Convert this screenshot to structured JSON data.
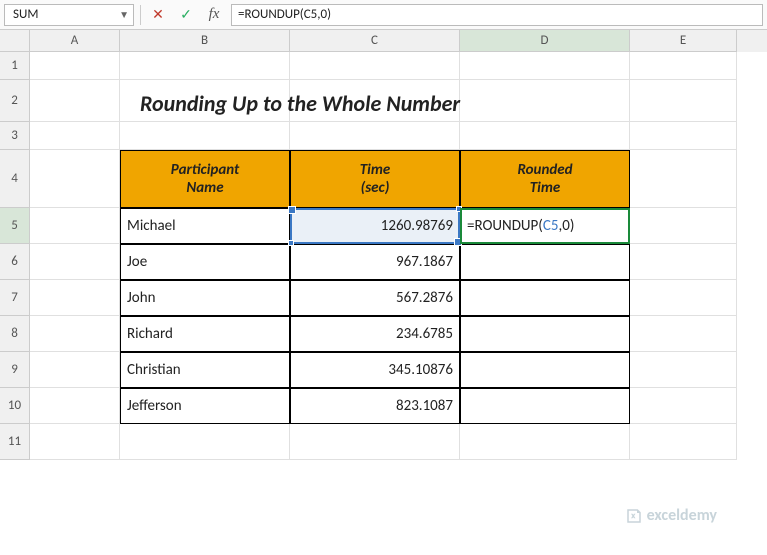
{
  "nameBox": "SUM",
  "formulaBar": "=ROUNDUP(C5,0)",
  "title": "Rounding Up to the Whole Number",
  "columns": [
    "A",
    "B",
    "C",
    "D",
    "E"
  ],
  "colWidths": {
    "A": 90,
    "B": 170,
    "C": 170,
    "D": 170,
    "E": 107
  },
  "headers": {
    "B": "Participant\nName",
    "C": "Time\n(sec)",
    "D": "Rounded\nTime"
  },
  "rows": [
    {
      "name": "Michael",
      "time": "1260.98769"
    },
    {
      "name": "Joe",
      "time": "967.1867"
    },
    {
      "name": "John",
      "time": "567.2876"
    },
    {
      "name": "Richard",
      "time": "234.6785"
    },
    {
      "name": "Christian",
      "time": "345.10876"
    },
    {
      "name": "Jefferson",
      "time": "823.1087"
    }
  ],
  "activeFormula": {
    "prefix": "=ROUNDUP(",
    "ref": "C5",
    "suffix": ",0)"
  },
  "watermark": "exceldemy",
  "chart_data": {
    "type": "table",
    "title": "Rounding Up to the Whole Number",
    "columns": [
      "Participant Name",
      "Time (sec)",
      "Rounded Time"
    ],
    "data": [
      [
        "Michael",
        1260.98769,
        null
      ],
      [
        "Joe",
        967.1867,
        null
      ],
      [
        "John",
        567.2876,
        null
      ],
      [
        "Richard",
        234.6785,
        null
      ],
      [
        "Christian",
        345.10876,
        null
      ],
      [
        "Jefferson",
        823.1087,
        null
      ]
    ]
  }
}
